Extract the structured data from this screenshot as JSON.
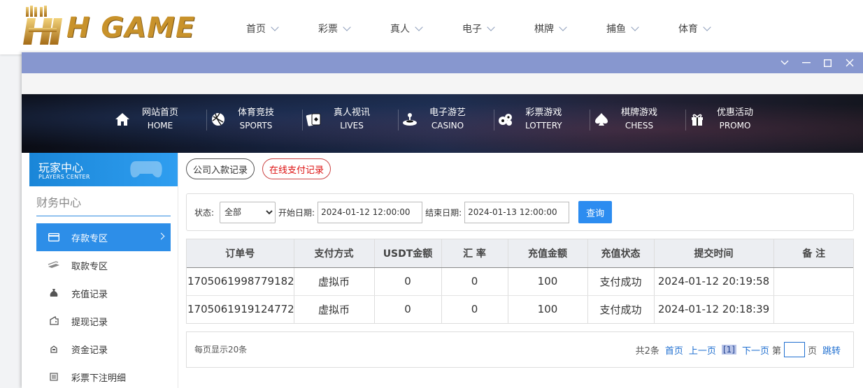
{
  "logo": {
    "text": "H GAME"
  },
  "top_nav": [
    {
      "label": "首页"
    },
    {
      "label": "彩票"
    },
    {
      "label": "真人"
    },
    {
      "label": "电子"
    },
    {
      "label": "棋牌"
    },
    {
      "label": "捕鱼"
    },
    {
      "label": "体育"
    }
  ],
  "banner_nav": [
    {
      "cn": "网站首页",
      "en": "HOME",
      "icon": "home-icon"
    },
    {
      "cn": "体育竞技",
      "en": "SPORTS",
      "icon": "ball-icon"
    },
    {
      "cn": "真人视讯",
      "en": "LIVES",
      "icon": "cards-icon"
    },
    {
      "cn": "电子游艺",
      "en": "CASINO",
      "icon": "joystick-icon"
    },
    {
      "cn": "彩票游戏",
      "en": "LOTTERY",
      "icon": "lottery-balls-icon"
    },
    {
      "cn": "棋牌游戏",
      "en": "CHESS",
      "icon": "spade-icon"
    },
    {
      "cn": "优惠活动",
      "en": "PROMO",
      "icon": "gift-icon"
    }
  ],
  "sidebar": {
    "title": "玩家中心",
    "subtitle": "PLAYERS CENTER",
    "section": "财务中心",
    "items": [
      {
        "label": "存款专区",
        "icon": "card-icon",
        "active": true
      },
      {
        "label": "取款专区",
        "icon": "cash-icon"
      },
      {
        "label": "充值记录",
        "icon": "money-bag-icon"
      },
      {
        "label": "提现记录",
        "icon": "wallet-icon"
      },
      {
        "label": "资金记录",
        "icon": "coins-icon"
      },
      {
        "label": "彩票下注明细",
        "icon": "list-icon"
      }
    ]
  },
  "tabs": [
    {
      "label": "公司入款记录"
    },
    {
      "label": "在线支付记录",
      "active": true
    }
  ],
  "filter": {
    "status_label": "状态:",
    "status_value": "全部",
    "start_label": "开始日期:",
    "start_value": "2024-01-12 12:00:00",
    "end_label": "结束日期:",
    "end_value": "2024-01-13 12:00:00",
    "query_label": "查询"
  },
  "table": {
    "headers": [
      "订单号",
      "支付方式",
      "USDT金额",
      "汇 率",
      "充值金额",
      "充值状态",
      "提交时间",
      "备 注"
    ],
    "rows": [
      [
        "1705061998779182",
        "虚拟币",
        "0",
        "0",
        "100",
        "支付成功",
        "2024-01-12 20:19:58",
        ""
      ],
      [
        "1705061919124772",
        "虚拟币",
        "0",
        "0",
        "100",
        "支付成功",
        "2024-01-12 20:18:39",
        ""
      ]
    ]
  },
  "pager": {
    "per_page": "每页显示20条",
    "total": "共2条",
    "first": "首页",
    "prev": "上一页",
    "current": "[1]",
    "next": "下一页",
    "goto_prefix": "第",
    "goto_suffix": "页",
    "jump": "跳转"
  },
  "colors": {
    "accent": "#2c8cf0",
    "titlebar": "#8797cf",
    "logo_gold": "#c8922b"
  }
}
